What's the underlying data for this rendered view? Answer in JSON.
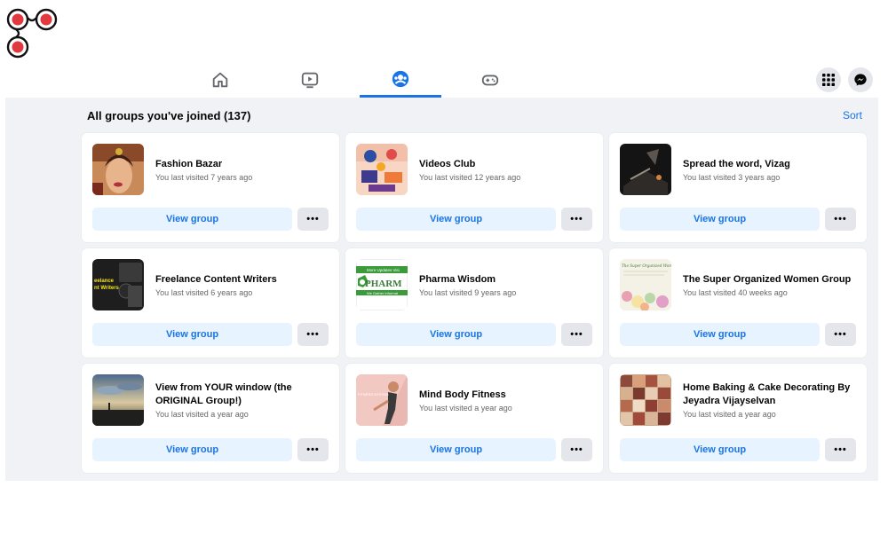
{
  "colors": {
    "accent": "#1b74e4",
    "background": "#f0f2f5",
    "logo_red": "#e03a3e"
  },
  "logo": {
    "name": "app-logo"
  },
  "nav": {
    "tabs": [
      {
        "icon": "home-icon",
        "active": false
      },
      {
        "icon": "watch-icon",
        "active": false
      },
      {
        "icon": "groups-icon",
        "active": true
      },
      {
        "icon": "gaming-icon",
        "active": false
      }
    ],
    "right_buttons": [
      {
        "icon": "menu-grid-icon"
      },
      {
        "icon": "messenger-icon"
      }
    ]
  },
  "groups_header": {
    "title": "All groups you've joined (137)",
    "sort_label": "Sort"
  },
  "groups": [
    {
      "name": "Fashion Bazar",
      "last_visited": "You last visited 7 years ago",
      "view_label": "View group",
      "more_label": "•••"
    },
    {
      "name": "Videos Club",
      "last_visited": "You last visited 12 years ago",
      "view_label": "View group",
      "more_label": "•••"
    },
    {
      "name": "Spread the word, Vizag",
      "last_visited": "You last visited 3 years ago",
      "view_label": "View group",
      "more_label": "•••"
    },
    {
      "name": "Freelance Content Writers",
      "last_visited": "You last visited 6 years ago",
      "view_label": "View group",
      "more_label": "•••"
    },
    {
      "name": "Pharma Wisdom",
      "last_visited": "You last visited 9 years ago",
      "view_label": "View group",
      "more_label": "•••"
    },
    {
      "name": "The Super Organized Women Group",
      "last_visited": "You last visited 40 weeks ago",
      "view_label": "View group",
      "more_label": "•••"
    },
    {
      "name": "View from YOUR window (the ORIGINAL Group!)",
      "last_visited": "You last visited a year ago",
      "view_label": "View group",
      "more_label": "•••"
    },
    {
      "name": "Mind Body Fitness",
      "last_visited": "You last visited a year ago",
      "view_label": "View group",
      "more_label": "•••"
    },
    {
      "name": "Home Baking & Cake Decorating By Jeyadra Vijayselvan",
      "last_visited": "You last visited a year ago",
      "view_label": "View group",
      "more_label": "•••"
    }
  ],
  "thumb_text": {
    "freelance": "eelance\nnt Writers",
    "pharma_top": "More Updates Visi",
    "pharma_main": "PHARM",
    "pharma_bottom": "We Gather Informat",
    "women": "The Super Organized Women",
    "fitness": "FITNESS SYSTEM"
  }
}
